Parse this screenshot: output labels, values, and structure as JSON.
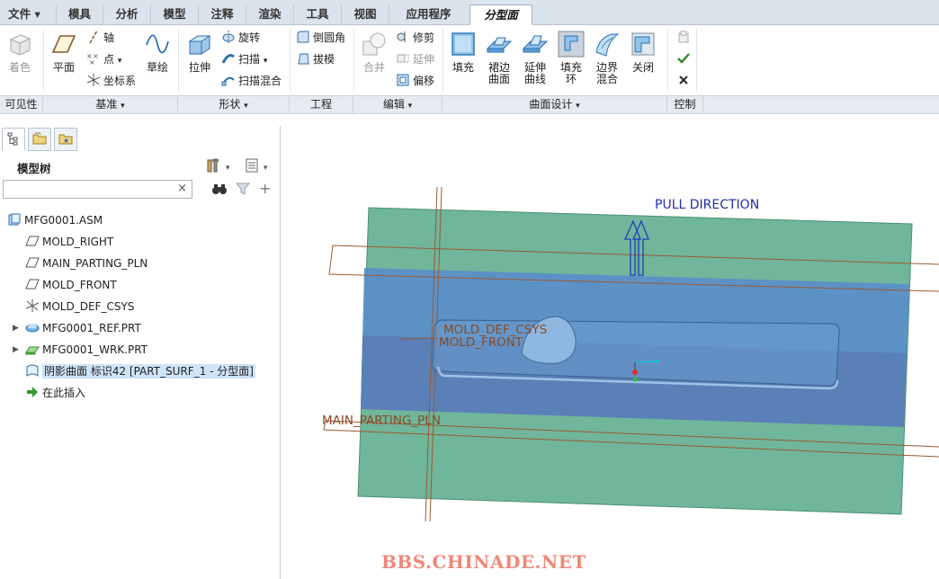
{
  "menubar": {
    "file": "文件",
    "tabs": [
      "模具",
      "分析",
      "模型",
      "注释",
      "渲染",
      "工具",
      "视图",
      "应用程序",
      "分型面"
    ]
  },
  "ribbon": {
    "visibility": {
      "shade": "着色"
    },
    "datum": {
      "plane": "平面",
      "axis": "轴",
      "point": "点",
      "csys": "坐标系",
      "sketch": "草绘"
    },
    "shapes": {
      "extrude": "拉伸",
      "revolve": "旋转",
      "sweep": "扫描",
      "swept_blend": "扫描混合"
    },
    "engineering": {
      "round": "倒圆角",
      "draft": "拔模"
    },
    "editing": {
      "merge": "合并",
      "trim": "修剪",
      "extend": "延伸",
      "offset": "偏移"
    },
    "surface_design": {
      "fill": "填充",
      "skirt_line1": "裙边",
      "skirt_line2": "曲面",
      "extend_line1": "延伸",
      "extend_line2": "曲线",
      "fill_ring_line1": "填充",
      "fill_ring_line2": "环",
      "boundary_line1": "边界",
      "boundary_line2": "混合",
      "close": "关闭"
    }
  },
  "groups": {
    "visibility": "可见性",
    "datum": "基准",
    "shapes": "形状",
    "engineering": "工程",
    "editing": "编辑",
    "surface_design": "曲面设计",
    "control": "控制"
  },
  "model_tree": {
    "title": "模型树",
    "search_value": "",
    "items": [
      {
        "label": "MFG0001.ASM",
        "icon": "assembly-icon"
      },
      {
        "label": "MOLD_RIGHT",
        "icon": "datum-plane-icon"
      },
      {
        "label": "MAIN_PARTING_PLN",
        "icon": "datum-plane-icon"
      },
      {
        "label": "MOLD_FRONT",
        "icon": "datum-plane-icon"
      },
      {
        "label": "MOLD_DEF_CSYS",
        "icon": "csys-icon"
      },
      {
        "label": "MFG0001_REF.PRT",
        "icon": "part-icon"
      },
      {
        "label": "MFG0001_WRK.PRT",
        "icon": "part-icon"
      },
      {
        "label": "阴影曲面 标识42 [PART_SURF_1 - 分型面]",
        "icon": "surface-icon"
      },
      {
        "label": "在此插入",
        "icon": "insert-arrow-icon"
      }
    ]
  },
  "viewport": {
    "pull_direction": "PULL DIRECTION",
    "csys_label": "MOLD_DEF_CSYS",
    "front_label": "MOLD_FRONT",
    "parting_label": "MAIN_PARTING_PLN"
  },
  "watermark": "BBS.CHINADE.NET",
  "colors": {
    "accent": "#2f6fb0",
    "parting_surface": "#5fae8d",
    "shaded_band": "#5b8fc4",
    "datum_line": "#9a5a32"
  }
}
